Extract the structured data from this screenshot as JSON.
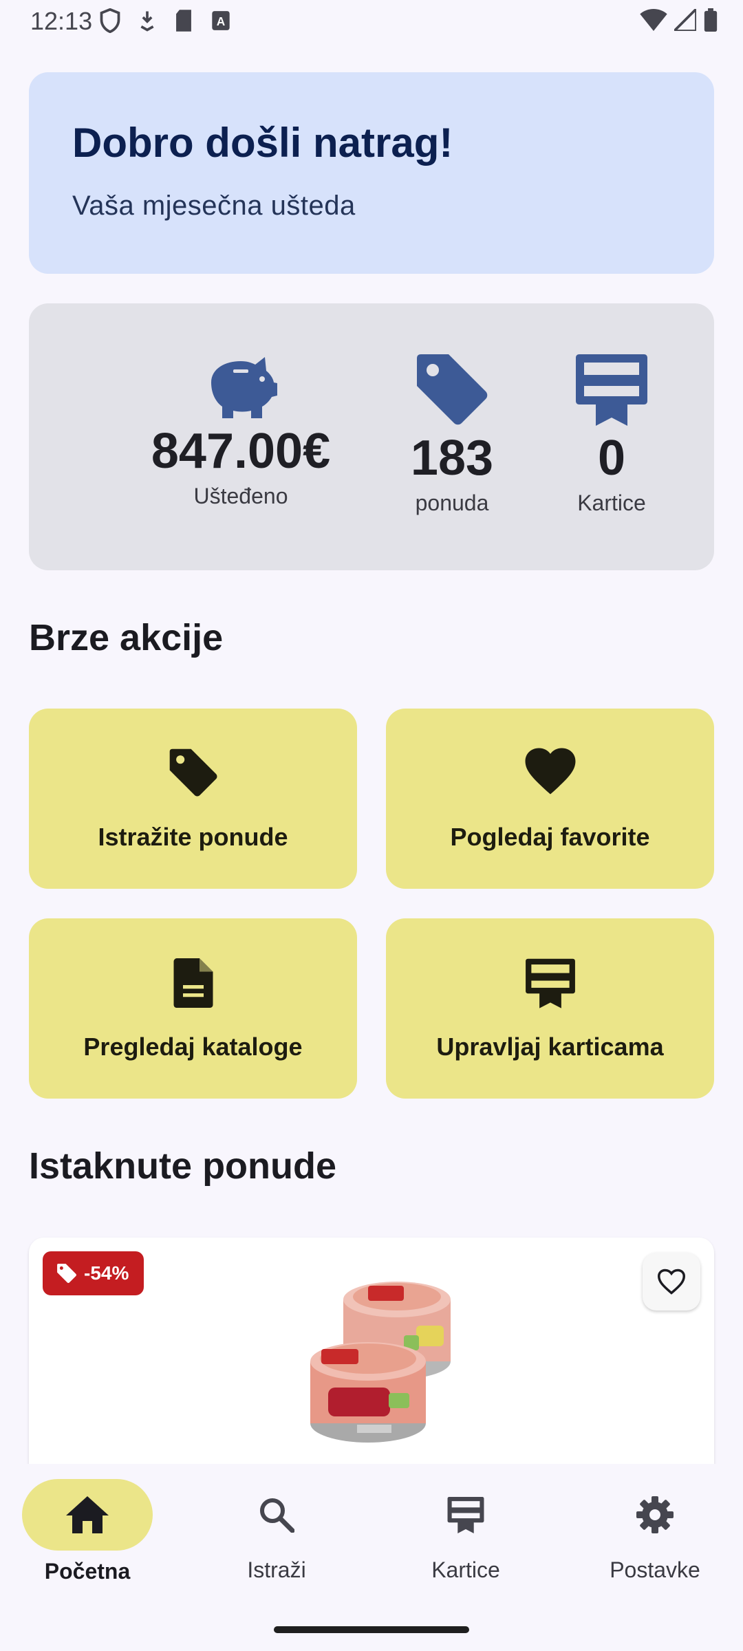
{
  "status_bar": {
    "time": "12:13",
    "icons": [
      "shield-icon",
      "download-icon",
      "sd-card-icon",
      "text-a-icon",
      "wifi-icon",
      "signal-icon",
      "battery-icon"
    ]
  },
  "welcome": {
    "title": "Dobro došli natrag!",
    "subtitle": "Vaša mjesečna ušteda"
  },
  "stats": [
    {
      "icon": "piggy-bank-icon",
      "value": "847.00€",
      "label": "Ušteđeno"
    },
    {
      "icon": "tag-icon",
      "value": "183",
      "label": "ponuda"
    },
    {
      "icon": "loyalty-card-icon",
      "value": "0",
      "label": "Kartice"
    }
  ],
  "quick_actions": {
    "title": "Brze akcije",
    "items": [
      {
        "icon": "tag-icon",
        "label": "Istražite ponude"
      },
      {
        "icon": "heart-icon",
        "label": "Pogledaj favorite"
      },
      {
        "icon": "document-icon",
        "label": "Pregledaj kataloge"
      },
      {
        "icon": "card-icon",
        "label": "Upravljaj karticama"
      }
    ]
  },
  "featured": {
    "title": "Istaknute ponude",
    "card": {
      "discount": "-54%",
      "product_image": "rio-mare-insalatissime-image"
    }
  },
  "bottom_nav": [
    {
      "icon": "home-icon",
      "label": "Početna",
      "active": true
    },
    {
      "icon": "search-icon",
      "label": "Istraži",
      "active": false
    },
    {
      "icon": "card-icon",
      "label": "Kartice",
      "active": false
    },
    {
      "icon": "gear-icon",
      "label": "Postavke",
      "active": false
    }
  ],
  "colors": {
    "background": "#f8f6fd",
    "welcome_bg": "#d7e2fb",
    "stats_bg": "#e2e2e8",
    "stat_icon": "#3d5a96",
    "tile_bg": "#ebe589",
    "discount_bg": "#c41d21"
  }
}
